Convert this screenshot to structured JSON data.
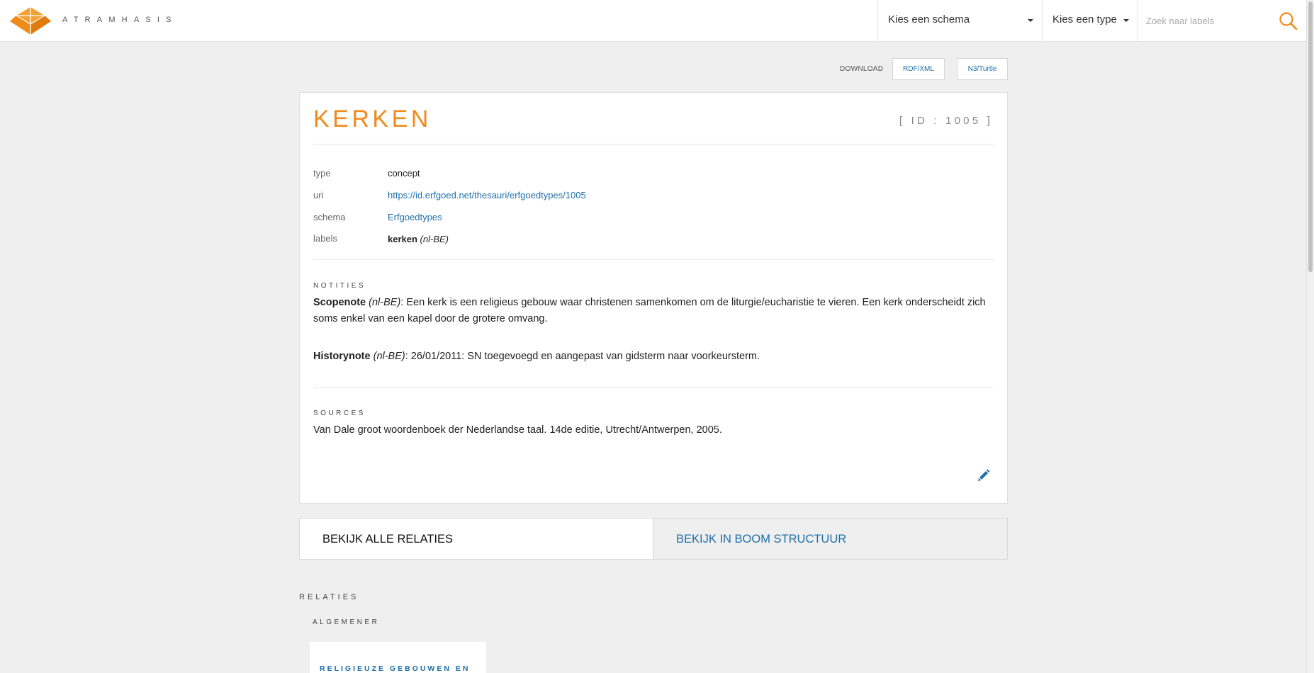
{
  "app": {
    "brand": "ATRAMHASIS"
  },
  "topbar": {
    "schema_select": "Kies een schema",
    "type_select": "Kies een type",
    "search_placeholder": "Zoek naar labels"
  },
  "download": {
    "label": "DOWNLOAD",
    "rdf": "RDF/XML",
    "n3": "N3/Turtle"
  },
  "concept": {
    "title": "KERKEN",
    "id_text": "[ ID : 1005 ]",
    "meta": {
      "type_key": "type",
      "type_val": "concept",
      "uri_key": "uri",
      "uri_val": "https://id.erfgoed.net/thesauri/erfgoedtypes/1005",
      "schema_key": "schema",
      "schema_val": "Erfgoedtypes",
      "labels_key": "labels",
      "label_term": "kerken",
      "label_lang": "(nl-BE)"
    },
    "notes_heading": "NOTITIES",
    "scopenote": {
      "label": "Scopenote",
      "lang": "(nl-BE)",
      "text": ": Een kerk is een religieus gebouw waar christenen samenkomen om de liturgie/eucharistie te vieren. Een kerk onderscheidt zich soms enkel van een kapel door de grotere omvang."
    },
    "historynote": {
      "label": "Historynote",
      "lang": "(nl-BE)",
      "text": ": 26/01/2011: SN toegevoegd en aangepast van gidsterm naar voorkeursterm."
    },
    "sources_heading": "SOURCES",
    "source_text": "Van Dale groot woordenboek der Nederlandse taal. 14de editie, Utrecht/Antwerpen, 2005."
  },
  "tabs": {
    "all_relations": "BEKIJK ALLE RELATIES",
    "tree": "BEKIJK IN BOOM STRUCTUUR"
  },
  "relations": {
    "heading": "RELATIES",
    "broader_heading": "ALGEMENER",
    "broader_item": "RELIGIEUZE GEBOUWEN EN"
  },
  "colors": {
    "accent": "#f08a1d",
    "link": "#1f6fa8",
    "background": "#efefef"
  }
}
